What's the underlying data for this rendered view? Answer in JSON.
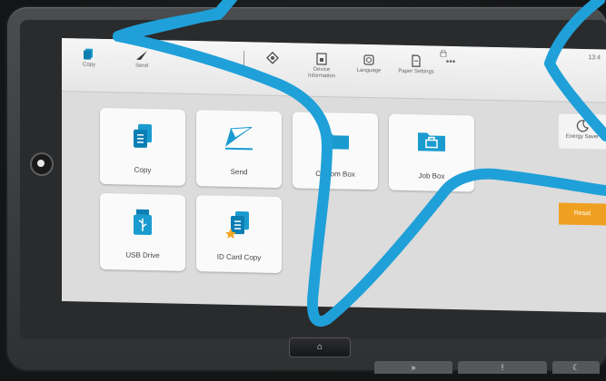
{
  "topbar": {
    "items": [
      {
        "label": "Copy",
        "icon": "copy-icon"
      },
      {
        "label": "Send",
        "icon": "send-icon"
      },
      {
        "label": "",
        "icon": "divider"
      },
      {
        "label": "",
        "icon": "status-icon"
      },
      {
        "label": "Device\nInformation",
        "icon": "device-info-icon"
      },
      {
        "label": "Language",
        "icon": "language-icon"
      },
      {
        "label": "Paper Settings",
        "icon": "paper-settings-icon"
      },
      {
        "label": "•••",
        "icon": "more-icon"
      }
    ],
    "clock": "13:4"
  },
  "tiles": [
    {
      "label": "Copy"
    },
    {
      "label": "Send"
    },
    {
      "label": "Custom Box"
    },
    {
      "label": "Job Box"
    },
    {
      "label": "USB Drive"
    },
    {
      "label": "ID Card Copy"
    }
  ],
  "side": {
    "energy_saver": "Energy Saver",
    "reset": "Reset"
  },
  "hardware": {
    "home_glyph": "⌂",
    "btn_start": "»",
    "btn_attention": "!",
    "btn_sleep": "☾"
  },
  "colors": {
    "accent": "#1a9bd0",
    "overlay_stroke": "#1fa0d8",
    "reset": "#f0a020"
  }
}
